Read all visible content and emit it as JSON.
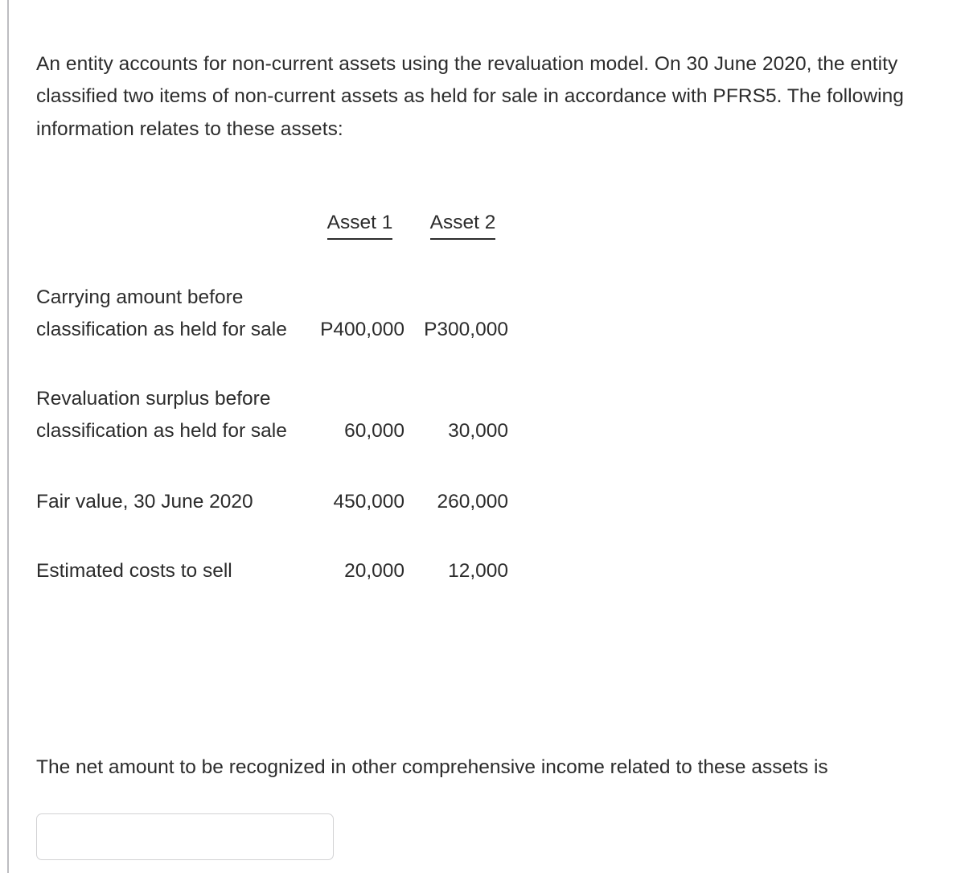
{
  "document": {
    "intro_paragraph": "An entity accounts for non-current assets using the revaluation model.  On 30 June 2020, the entity classified two items of non-current assets as held for sale in accordance with PFRS5.  The following information relates to these assets:",
    "question_text": "The net amount to be recognized in other comprehensive income related to these assets is"
  },
  "table": {
    "columns": [
      {
        "header": ""
      },
      {
        "header": "Asset 1"
      },
      {
        "header": "Asset 2"
      }
    ],
    "rows": [
      {
        "label": "Carrying amount before classification as held for sale",
        "asset_1": "P400,000",
        "asset_2": "P300,000"
      },
      {
        "label": "Revaluation surplus before classification as held for sale",
        "asset_1": "60,000",
        "asset_2": "30,000"
      },
      {
        "label": "Fair value, 30 June 2020",
        "asset_1": "450,000",
        "asset_2": "260,000"
      },
      {
        "label": "Estimated costs to sell",
        "asset_1": "20,000",
        "asset_2": "12,000"
      }
    ]
  },
  "answer": {
    "value": "",
    "placeholder": ""
  },
  "colors": {
    "text": "#2c2c2c",
    "rule": "#bdbdc1",
    "input_border": "#d2d2d4",
    "background": "#ffffff"
  }
}
